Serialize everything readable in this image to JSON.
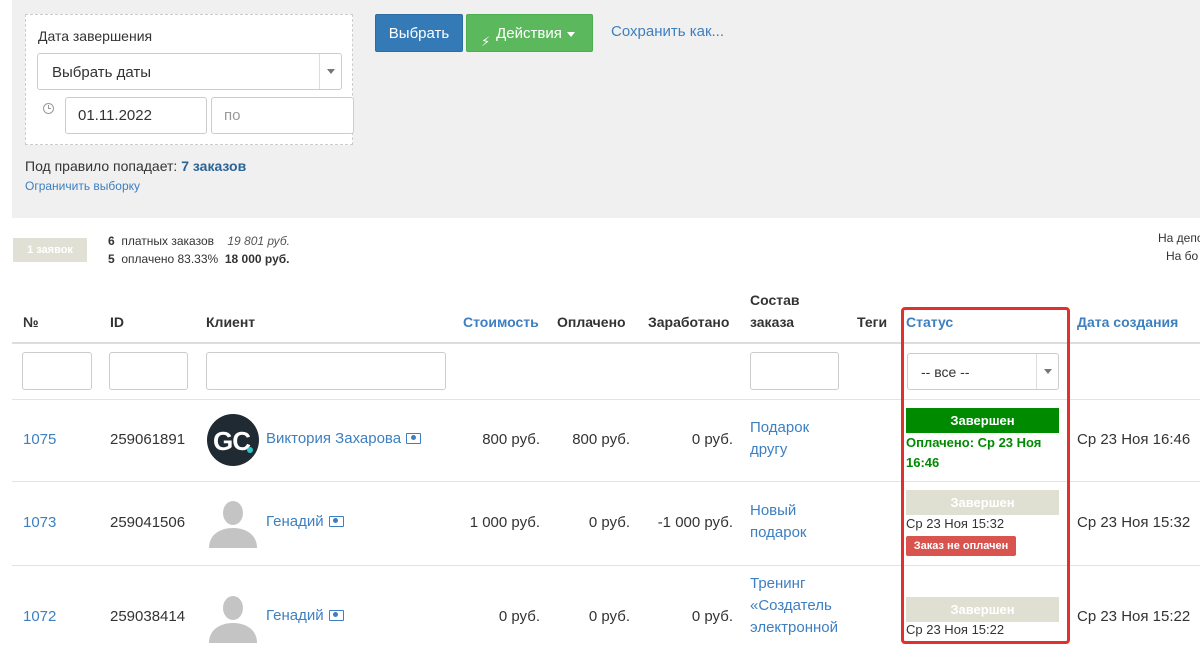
{
  "filter": {
    "title": "Дата завершения",
    "date_select_value": "Выбрать даты",
    "date_from": "01.11.2022",
    "date_to_placeholder": "по"
  },
  "toolbar": {
    "choose_label": "Выбрать",
    "actions_label": "Действия",
    "save_as_label": "Сохранить как..."
  },
  "rule": {
    "prefix": "Под правило попадает:",
    "count": "7 заказов",
    "limit_link": "Ограничить выборку"
  },
  "summary": {
    "requests_badge": "1 заявок",
    "paid_count": "6",
    "paid_label": "платных заказов",
    "paid_sum": "19 801 руб.",
    "done_count": "5",
    "done_label": "оплачено 83.33%",
    "done_sum": "18 000 руб.",
    "right_line1": "На депо",
    "right_line2": "На бо"
  },
  "table": {
    "headers": {
      "num": "№",
      "id": "ID",
      "client": "Клиент",
      "cost": "Стоимость",
      "paid": "Оплачено",
      "earned": "Заработано",
      "composition_line1": "Состав",
      "composition_line2": "заказа",
      "tags": "Теги",
      "status": "Статус",
      "created": "Дата создания"
    },
    "status_filter_value": "-- все --",
    "rows": [
      {
        "num": "1075",
        "id": "259061891",
        "client": "Виктория Захарова",
        "cost": "800 руб.",
        "paid": "800 руб.",
        "earned": "0 руб.",
        "composition": "Подарок другу",
        "status": "Завершен",
        "paid_note": "Оплачено: Ср 23 Ноя 16:46",
        "created": "Ср 23 Ноя 16:46"
      },
      {
        "num": "1073",
        "id": "259041506",
        "client": "Генадий",
        "cost": "1 000 руб.",
        "paid": "0 руб.",
        "earned": "-1 000 руб.",
        "composition": "Новый подарок",
        "status": "Завершен",
        "status_date": "Ср 23 Ноя 15:32",
        "unpaid_note": "Заказ не оплачен",
        "created": "Ср 23 Ноя 15:32"
      },
      {
        "num": "1072",
        "id": "259038414",
        "client": "Генадий",
        "cost": "0 руб.",
        "paid": "0 руб.",
        "earned": "0 руб.",
        "composition": "Тренинг «Создатель электронной",
        "status": "Завершен",
        "status_date": "Ср 23 Ноя 15:22",
        "created": "Ср 23 Ноя 15:22"
      }
    ]
  },
  "colors": {
    "link": "#3d7fc1",
    "primary_button": "#337ab7",
    "success_button": "#5cb85c",
    "status_done": "#008a00",
    "status_done_muted": "#e0e0d2",
    "unpaid": "#d9534f",
    "highlight_border": "#e0312c"
  }
}
